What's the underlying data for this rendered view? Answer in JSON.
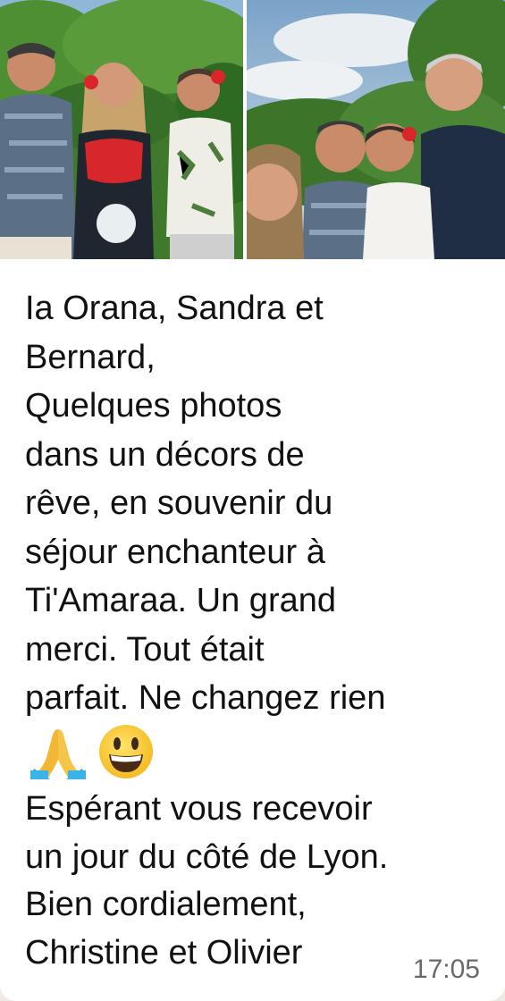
{
  "message": {
    "photos": [
      {
        "icon": "photo-three-people-garden"
      },
      {
        "icon": "photo-four-people-selfie"
      }
    ],
    "text_part1": "Ia Orana, Sandra et\nBernard,\nQuelques photos\ndans un décors de\nrêve, en souvenir du\nséjour enchanteur à\nTi'Amaraa. Un grand\nmerci. Tout était\nparfait. Ne changez rien",
    "emojis": [
      "folded-hands-icon",
      "grinning-face-icon"
    ],
    "text_part2": "Espérant vous recevoir\nun jour du côté de Lyon.\nBien cordialement,\nChristine et Olivier",
    "timestamp": "17:05"
  },
  "colors": {
    "bubble": "#ffffff",
    "text": "#111111",
    "timestamp": "#666a6e",
    "background": "#efeae2"
  }
}
